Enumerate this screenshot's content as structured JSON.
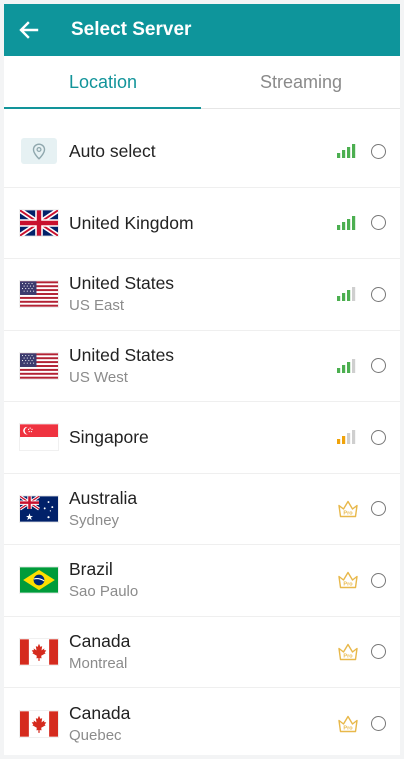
{
  "header": {
    "title": "Select Server"
  },
  "tabs": [
    {
      "label": "Location",
      "active": true
    },
    {
      "label": "Streaming",
      "active": false
    }
  ],
  "servers": [
    {
      "id": "auto",
      "name": "Auto select",
      "sub": "",
      "icon": "location-pin-icon",
      "signal": "strong",
      "pro": false,
      "selected": false
    },
    {
      "id": "uk",
      "name": "United Kingdom",
      "sub": "",
      "icon": "uk-flag",
      "signal": "strong",
      "pro": false,
      "selected": false
    },
    {
      "id": "us-east",
      "name": "United States",
      "sub": "US East",
      "icon": "us-flag",
      "signal": "medium-high",
      "pro": false,
      "selected": false
    },
    {
      "id": "us-west",
      "name": "United States",
      "sub": "US West",
      "icon": "us-flag",
      "signal": "medium-high",
      "pro": false,
      "selected": false
    },
    {
      "id": "sg",
      "name": "Singapore",
      "sub": "",
      "icon": "singapore-flag",
      "signal": "medium",
      "pro": false,
      "selected": false
    },
    {
      "id": "au",
      "name": "Australia",
      "sub": "Sydney",
      "icon": "australia-flag",
      "signal": "",
      "pro": true,
      "pro_badge": "Pro",
      "selected": false
    },
    {
      "id": "br",
      "name": "Brazil",
      "sub": "Sao Paulo",
      "icon": "brazil-flag",
      "signal": "",
      "pro": true,
      "pro_badge": "Pro",
      "selected": false
    },
    {
      "id": "ca-mtl",
      "name": "Canada",
      "sub": "Montreal",
      "icon": "canada-flag",
      "signal": "",
      "pro": true,
      "pro_badge": "Pro",
      "selected": false
    },
    {
      "id": "ca-qc",
      "name": "Canada",
      "sub": "Quebec",
      "icon": "canada-flag",
      "signal": "",
      "pro": true,
      "pro_badge": "Pro",
      "selected": false
    }
  ],
  "colors": {
    "header_bg": "#0e959b",
    "accent": "#12949a",
    "signal_good": "#4caf50",
    "signal_medium": "#f0a30a",
    "pro_crown": "#e8b84a"
  }
}
